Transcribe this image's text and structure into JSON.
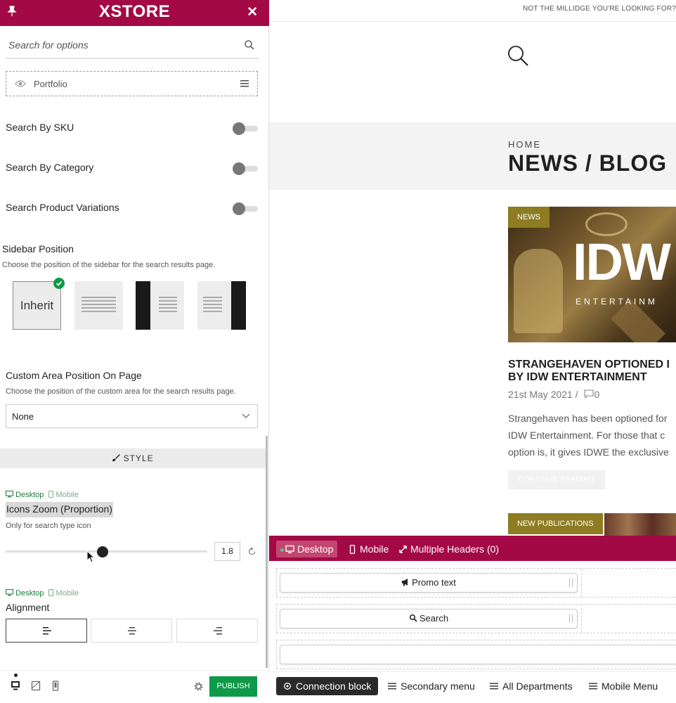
{
  "customizer": {
    "brand": "XSTORE",
    "search": {
      "placeholder": "Search for options"
    },
    "portfolio_label": "Portfolio",
    "toggles": [
      {
        "label": "Search By SKU",
        "on": false
      },
      {
        "label": "Search By Category",
        "on": false
      },
      {
        "label": "Search Product Variations",
        "on": false
      }
    ],
    "sidebar_position": {
      "title": "Sidebar Position",
      "description": "Choose the position of the sidebar for the search results page.",
      "options": [
        "Inherit",
        "full-width",
        "left-sidebar",
        "right-sidebar"
      ],
      "selected_label": "Inherit"
    },
    "custom_area": {
      "title": "Custom Area Position On Page",
      "description": "Choose the position of the custom area for the search results page.",
      "value": "None"
    },
    "style_section": "STYLE",
    "device_tabs": {
      "desktop": "Desktop",
      "mobile": "Mobile"
    },
    "icons_zoom": {
      "title": "Icons Zoom (Proportion)",
      "description": "Only for search type icon",
      "value": "1.8",
      "slider_fraction": 0.48
    },
    "alignment": {
      "title": "Alignment",
      "options": [
        "left",
        "center",
        "right"
      ],
      "selected": "left"
    },
    "publish_label": "PUBLISH",
    "accent": "#a30a45",
    "publish_color": "#0e9a49"
  },
  "preview": {
    "top_notice": "NOT THE MILLIDGE YOU'RE LOOKING FOR?",
    "breadcrumb": "HOME",
    "page_title": "NEWS / BLOG",
    "post": {
      "tag": "NEWS",
      "image_text": "IDW",
      "image_subtext": "ENTERTAINM",
      "title_line1": "STRANGEHAVEN OPTIONED I",
      "title_line2": "BY IDW ENTERTAINMENT",
      "date": "21st May 2021 /",
      "comments": "0",
      "excerpt": [
        "Strangehaven has been optioned for",
        "IDW Entertainment. For those that c",
        "option is, it gives IDWE the exclusive"
      ],
      "continue_label": "CONTINUE READING"
    },
    "next_tag": "NEW PUBLICATIONS"
  },
  "header_builder": {
    "tabs": {
      "desktop": "Desktop",
      "mobile": "Mobile",
      "multiple": "Multiple Headers (0)"
    },
    "elements": [
      "Promo text",
      "Search"
    ],
    "footer": {
      "connection": "Connection block",
      "secondary": "Secondary menu",
      "departments": "All Departments",
      "mobile_menu": "Mobile Menu"
    }
  }
}
